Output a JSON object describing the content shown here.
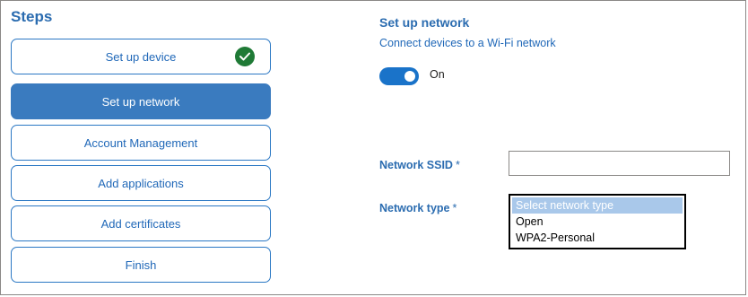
{
  "steps": {
    "title": "Steps",
    "items": [
      {
        "label": "Set up device",
        "state": "completed"
      },
      {
        "label": "Set up network",
        "state": "active"
      },
      {
        "label": "Account Management",
        "state": "pending"
      },
      {
        "label": "Add applications",
        "state": "pending"
      },
      {
        "label": "Add certificates",
        "state": "pending"
      },
      {
        "label": "Finish",
        "state": "pending"
      }
    ]
  },
  "network": {
    "title": "Set up network",
    "subtitle": "Connect devices to a Wi-Fi network",
    "toggle": {
      "state": "on",
      "label": "On"
    },
    "ssid": {
      "label": "Network SSID",
      "required_mark": "*",
      "value": ""
    },
    "type": {
      "label": "Network type",
      "required_mark": "*",
      "placeholder": "Select network type",
      "options": [
        "Open",
        "WPA2-Personal"
      ]
    }
  },
  "icons": {
    "completed": "checkmark-circle-icon"
  },
  "colors": {
    "accent": "#2b6cb0",
    "active_step_bg": "#3a7bbf",
    "toggle_on": "#1a73c9",
    "success": "#1f7a36",
    "listbox_highlight": "#a9c8ea"
  }
}
